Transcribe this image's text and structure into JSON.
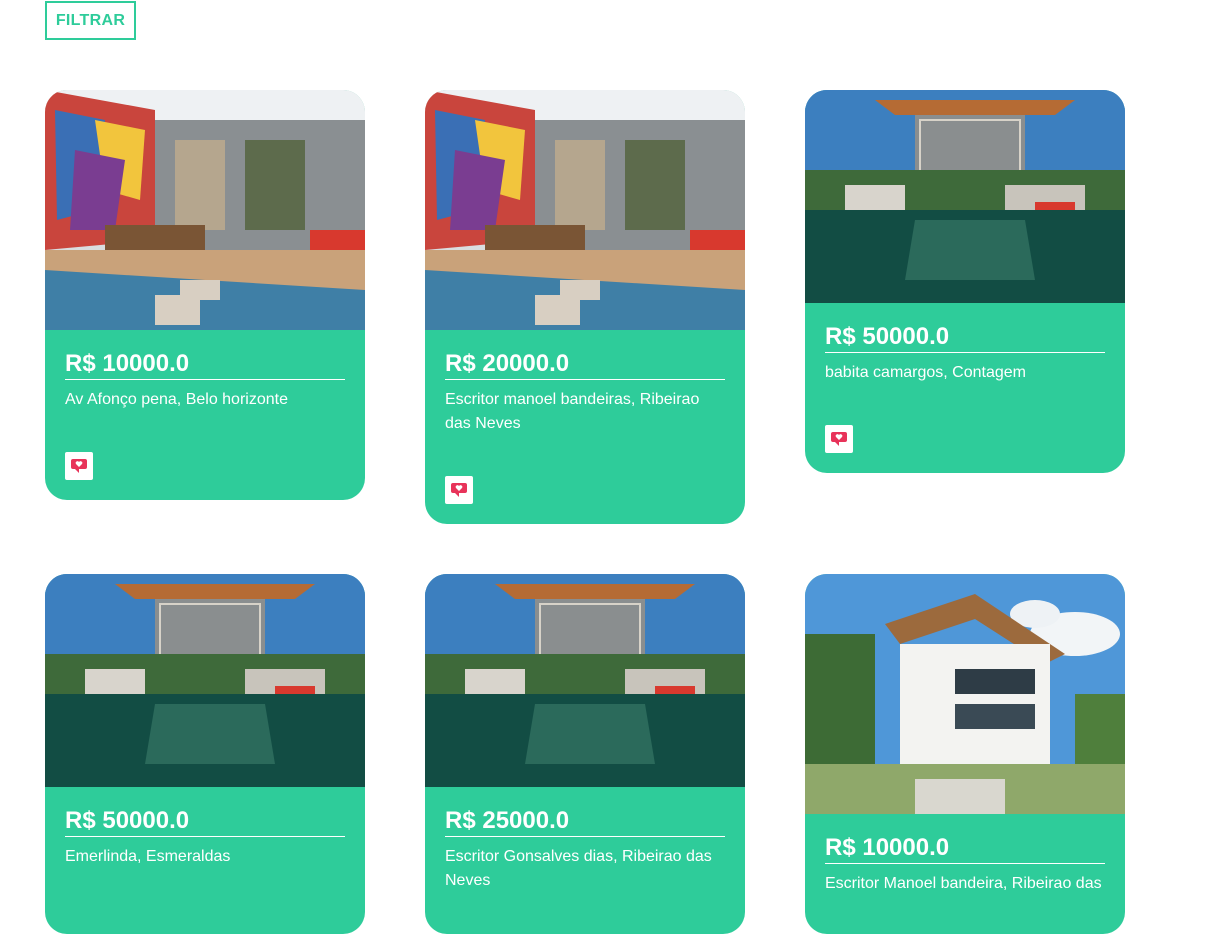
{
  "filter": {
    "label": "FILTRAR"
  },
  "listings": [
    {
      "price": "R$ 10000.0",
      "address": "Av Afonço pena, Belo horizonte"
    },
    {
      "price": "R$ 20000.0",
      "address": "Escritor manoel bandeiras, Ribeirao das Neves"
    },
    {
      "price": "R$ 50000.0",
      "address": "babita camargos, Contagem"
    },
    {
      "price": "R$ 50000.0",
      "address": "Emerlinda, Esmeraldas"
    },
    {
      "price": "R$ 25000.0",
      "address": "Escritor Gonsalves dias, Ribeirao das Neves"
    },
    {
      "price": "R$ 10000.0",
      "address": "Escritor Manoel bandeira, Ribeirao das"
    }
  ],
  "colors": {
    "accent": "#2ecc9a",
    "text_on_accent": "#ffffff",
    "favorite_icon": "#e8335a"
  },
  "icons": {
    "favorite": "heart-message-icon"
  }
}
